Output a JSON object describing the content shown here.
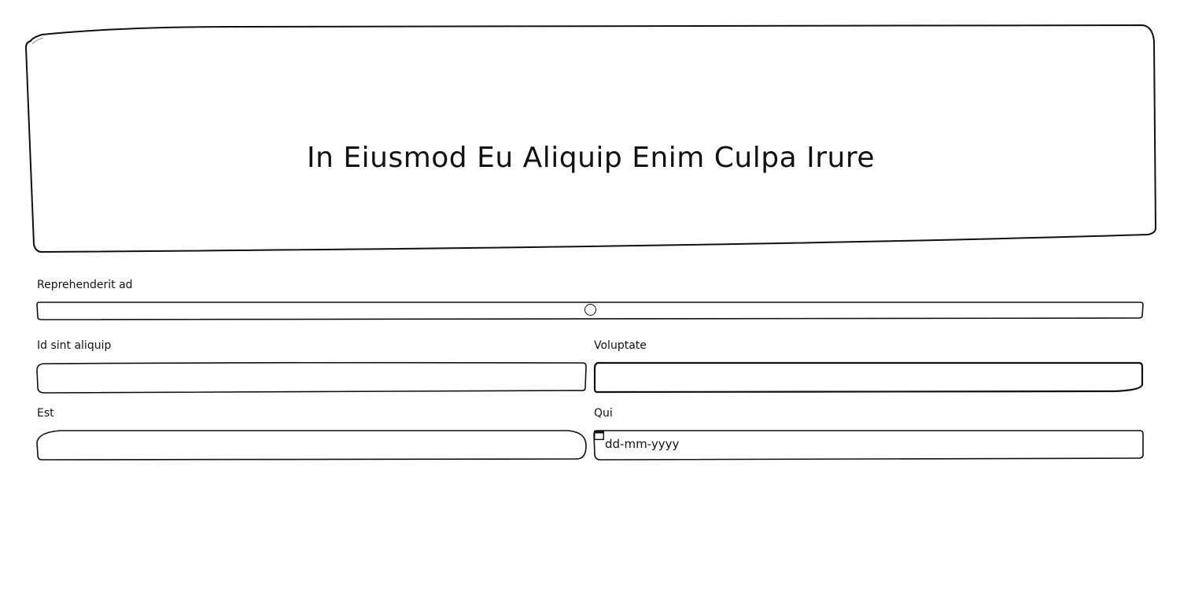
{
  "hero": {
    "title": "In Eiusmod Eu Aliquip Enim Culpa Irure"
  },
  "form": {
    "slider": {
      "label": "Reprehenderit ad",
      "value": 0.5
    },
    "field_id": {
      "label": "Id sint aliquip",
      "value": ""
    },
    "field_voluptate": {
      "label": "Voluptate",
      "value": ""
    },
    "field_est": {
      "label": "Est",
      "value": ""
    },
    "field_qui": {
      "label": "Qui",
      "placeholder": "dd-mm-yyyy"
    }
  },
  "icons": {
    "date": "calendar-icon"
  }
}
